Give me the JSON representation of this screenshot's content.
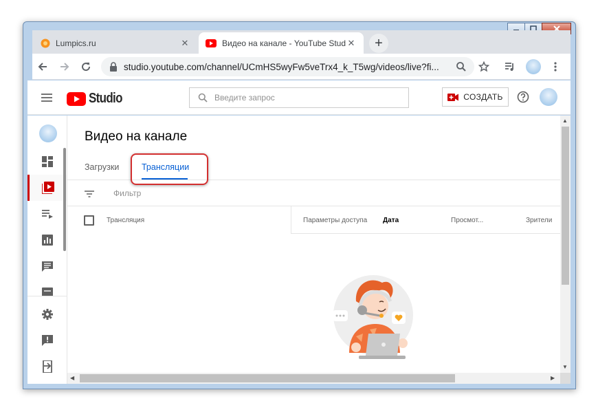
{
  "browser": {
    "tabs": [
      {
        "title": "Lumpics.ru",
        "favicon": "lumpics-orange-icon"
      },
      {
        "title": "Видео на канале - YouTube Studio",
        "favicon": "youtube-red-icon"
      }
    ],
    "new_tab": "+",
    "url": "studio.youtube.com/channel/UCmHS5wyFw5veTrx4_k_T5wg/videos/live?fi..."
  },
  "studio": {
    "logo_text": "Studio",
    "search_placeholder": "Введите запрос",
    "create_label": "СОЗДАТЬ"
  },
  "page": {
    "title": "Видео на канале",
    "tabs": [
      {
        "label": "Загрузки"
      },
      {
        "label": "Трансляции"
      }
    ],
    "filter_label": "Фильтр",
    "columns": [
      "Трансляция",
      "Параметры доступа",
      "Дата",
      "Просмот...",
      "Зрители"
    ]
  },
  "colors": {
    "accent": "#065fd4",
    "brand_red": "#ff0000",
    "highlight_red": "#d32f2f"
  }
}
